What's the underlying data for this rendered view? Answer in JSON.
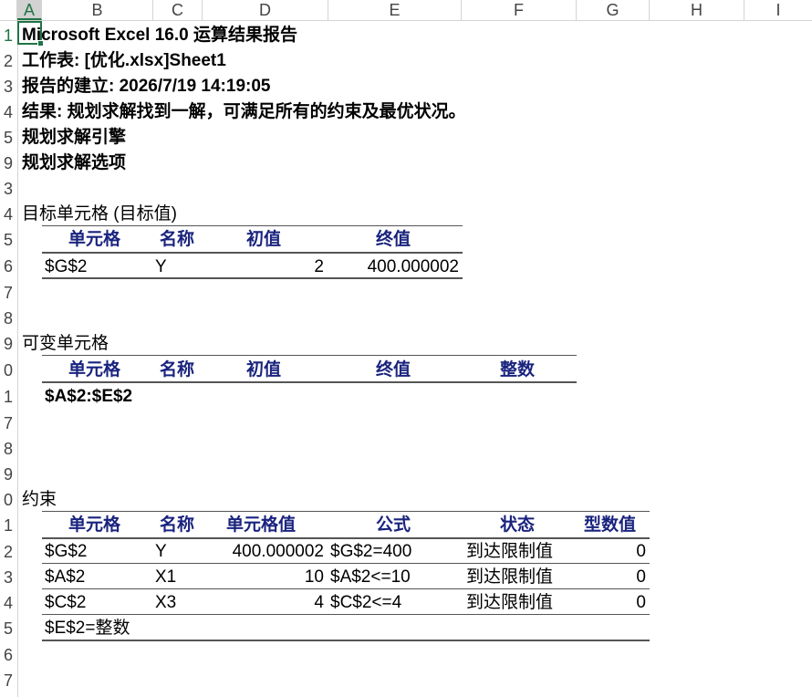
{
  "columns": [
    "A",
    "B",
    "C",
    "D",
    "E",
    "F",
    "G",
    "H",
    "I"
  ],
  "selected_column": "A",
  "rows": {
    "r1": "1",
    "r2": "2",
    "r3": "3",
    "r4": "4",
    "r5": "5",
    "r9": "9",
    "r13": "3",
    "r14": "4",
    "r15": "5",
    "r16": "6",
    "r17": "7",
    "r18": "8",
    "r19": "9",
    "r20": "0",
    "r21": "1",
    "r27": "7",
    "r28": "8",
    "r29": "9",
    "r30": "0",
    "r31": "1",
    "r32": "2",
    "r33": "3",
    "r34": "4",
    "r35": "5",
    "r36": "6",
    "r37": "7"
  },
  "report": {
    "title": "Microsoft Excel 16.0 运算结果报告",
    "worksheet": "工作表: [优化.xlsx]Sheet1",
    "created": "报告的建立: 2026/7/19 14:19:05",
    "result": "结果: 规划求解找到一解，可满足所有的约束及最优状况。",
    "engine": "规划求解引擎",
    "options": "规划求解选项"
  },
  "objective": {
    "section_title": "目标单元格 (目标值)",
    "headers": {
      "cell": "单元格",
      "name": "名称",
      "initial": "初值",
      "final": "终值"
    },
    "row": {
      "cell": "$G$2",
      "name": "Y",
      "initial": "2",
      "final": "400.000002"
    }
  },
  "variables": {
    "section_title": "可变单元格",
    "headers": {
      "cell": "单元格",
      "name": "名称",
      "initial": "初值",
      "final": "终值",
      "integer": "整数"
    },
    "row": {
      "cell": "$A$2:$E$2"
    }
  },
  "constraints": {
    "section_title": "约束",
    "headers": {
      "cell": "单元格",
      "name": "名称",
      "value": "单元格值",
      "formula": "公式",
      "status": "状态",
      "slack": "型数值"
    },
    "rows": [
      {
        "cell": "$G$2",
        "name": "Y",
        "value": "400.000002",
        "formula": "$G$2=400",
        "status": "到达限制值",
        "slack": "0"
      },
      {
        "cell": "$A$2",
        "name": "X1",
        "value": "10",
        "formula": "$A$2<=10",
        "status": "到达限制值",
        "slack": "0"
      },
      {
        "cell": "$C$2",
        "name": "X3",
        "value": "4",
        "formula": "$C$2<=4",
        "status": "到达限制值",
        "slack": "0"
      }
    ],
    "integer_note": "$E$2=整数"
  }
}
